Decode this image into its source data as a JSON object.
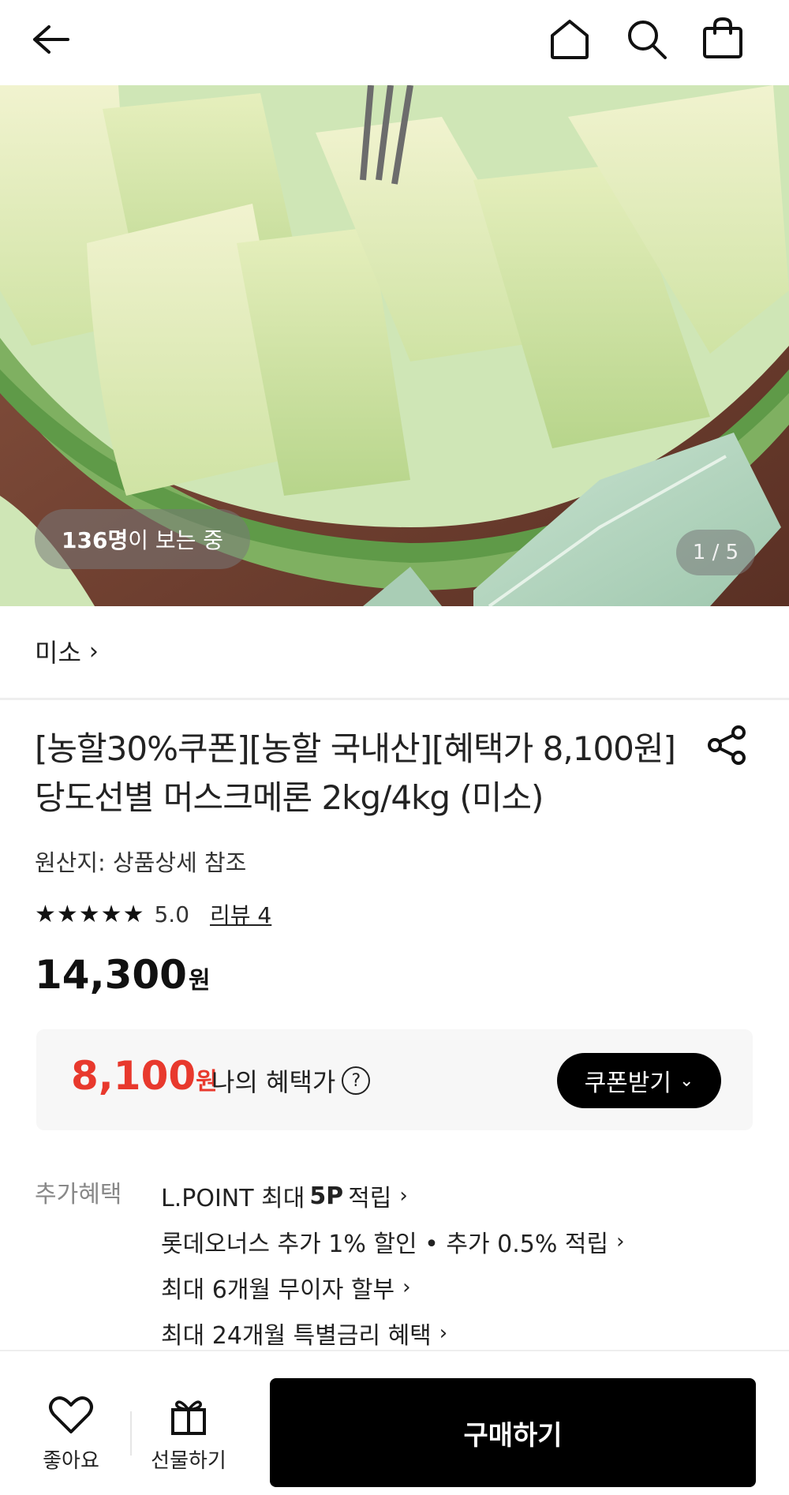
{
  "header": {
    "back_icon": "arrow-left-icon",
    "home_icon": "home-icon",
    "search_icon": "search-icon",
    "bag_icon": "shopping-bag-icon"
  },
  "gallery": {
    "viewers_count": "136명",
    "viewers_suffix": "이 보는 중",
    "pager": "1 / 5"
  },
  "brand": {
    "name": "미소",
    "chevron": "›"
  },
  "product": {
    "title": "[농할30%쿠폰][농할 국내산][혜택가 8,100원] 당도선별 머스크메론 2kg/4kg (미소)",
    "origin": "원산지: 상품상세 참조",
    "rating_stars": "★★★★★",
    "rating_score": "5.0",
    "rating_value": 5.0,
    "reviews_label": "리뷰 4",
    "price": "14,300",
    "price_unit": "원"
  },
  "benefit": {
    "price": "8,100",
    "price_unit": "원",
    "label": "나의 혜택가",
    "help": "?",
    "coupon_button": "쿠폰받기",
    "coupon_chevron": "⌄"
  },
  "extra": {
    "label": "추가혜택",
    "item1_pre": "L.POINT 최대",
    "item1_bold": "5P",
    "item1_post": "적립",
    "item2": "롯데오너스 추가 1% 할인 • 추가 0.5% 적립",
    "item3": "최대 6개월 무이자 할부",
    "item4": "최대 24개월 특별금리 혜택",
    "chevron": "›"
  },
  "bottom": {
    "like_label": "좋아요",
    "gift_label": "선물하기",
    "buy_label": "구매하기"
  },
  "colors": {
    "accent_red": "#e8392d",
    "primary_black": "#000000",
    "muted_gray": "#888888"
  }
}
